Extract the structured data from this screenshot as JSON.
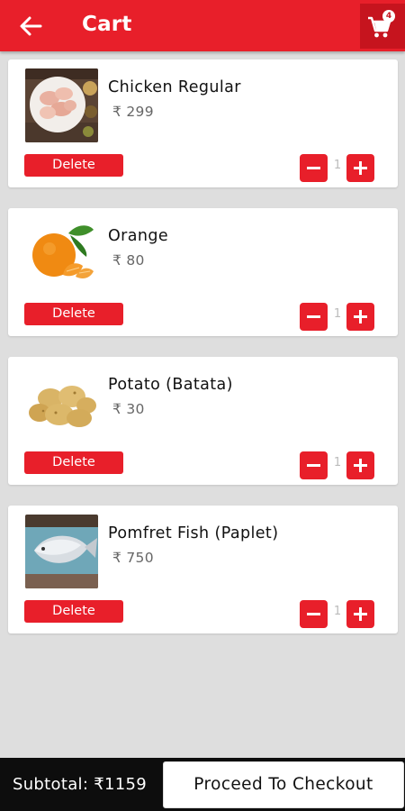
{
  "header": {
    "title": "Cart",
    "back_icon": "arrow-left-icon",
    "cart_icon": "shopping-cart-icon",
    "cart_count": "4",
    "color": "#e81f2a"
  },
  "items": [
    {
      "name": "Chicken Regular",
      "price": "₹ 299",
      "quantity": "1",
      "delete_label": "Delete",
      "image": "raw-chicken-image"
    },
    {
      "name": "Orange",
      "price": "₹ 80",
      "quantity": "1",
      "delete_label": "Delete",
      "image": "orange-image"
    },
    {
      "name": "Potato (Batata)",
      "price": "₹ 30",
      "quantity": "1",
      "delete_label": "Delete",
      "image": "potatoes-image"
    },
    {
      "name": "Pomfret Fish (Paplet)",
      "price": "₹ 750",
      "quantity": "1",
      "delete_label": "Delete",
      "image": "pomfret-fish-image"
    }
  ],
  "footer": {
    "subtotal": "Subtotal: ₹1159",
    "checkout_label": "Proceed To Checkout"
  }
}
